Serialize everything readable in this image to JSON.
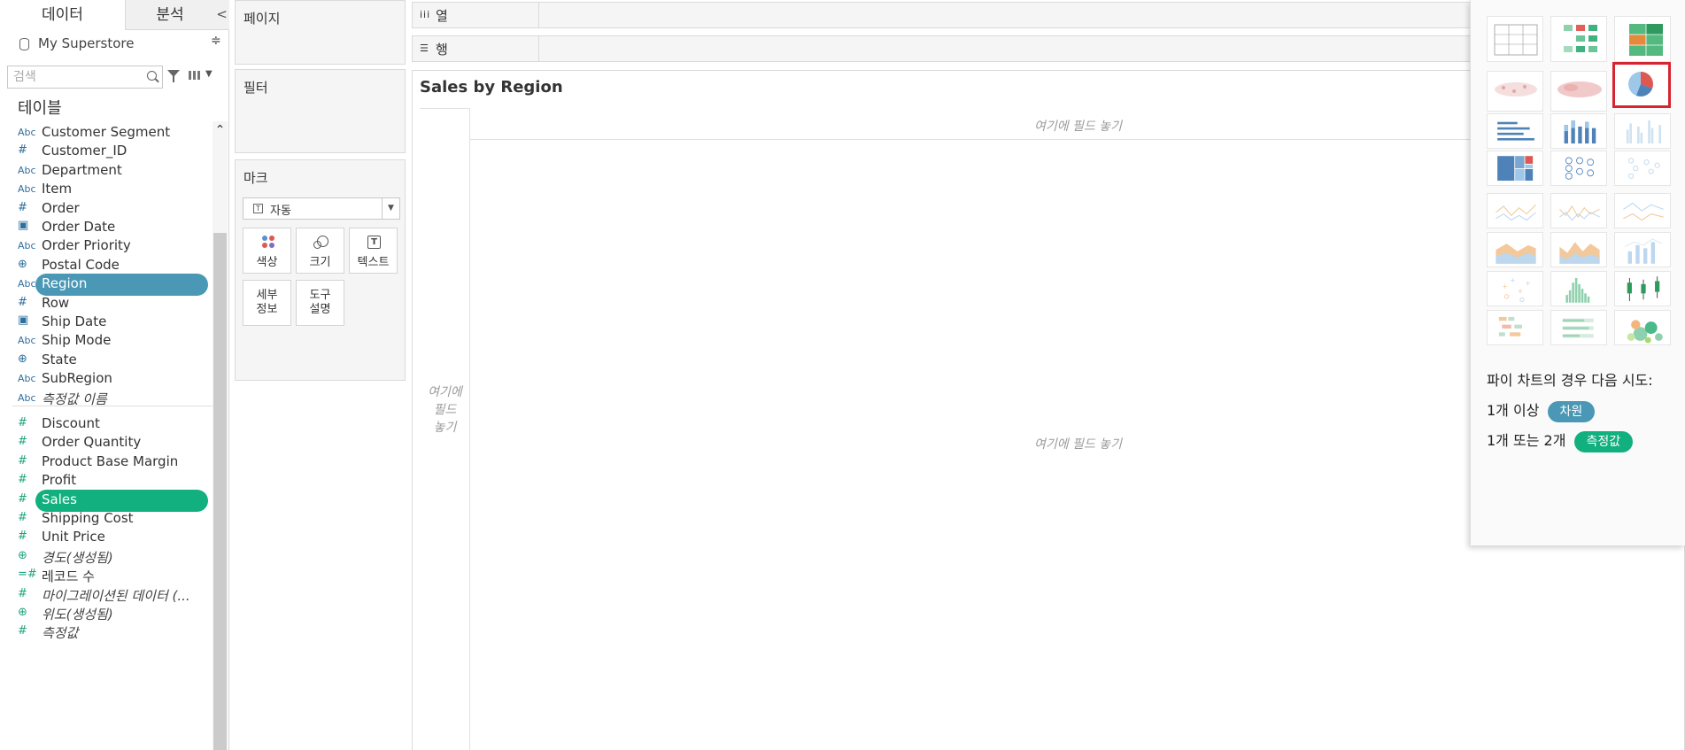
{
  "tabs": {
    "data": "데이터",
    "analysis": "분석",
    "collapse": "<"
  },
  "datasource": {
    "name": "My Superstore",
    "sort_icon": "≑"
  },
  "search": {
    "placeholder": "검색"
  },
  "tables_label": "테이블",
  "dimensions": [
    {
      "icon": "Abc",
      "type": "string",
      "label": "Customer Segment",
      "italic": false
    },
    {
      "icon": "#",
      "type": "number",
      "label": "Customer_ID",
      "italic": false
    },
    {
      "icon": "Abc",
      "type": "string",
      "label": "Department",
      "italic": false
    },
    {
      "icon": "Abc",
      "type": "string",
      "label": "Item",
      "italic": false
    },
    {
      "icon": "#",
      "type": "number",
      "label": "Order",
      "italic": false
    },
    {
      "icon": "date",
      "type": "date",
      "label": "Order Date",
      "italic": false
    },
    {
      "icon": "Abc",
      "type": "string",
      "label": "Order Priority",
      "italic": false
    },
    {
      "icon": "geo",
      "type": "geo",
      "label": "Postal Code",
      "italic": false
    },
    {
      "icon": "Abc",
      "type": "string",
      "label": "Region",
      "italic": false,
      "selected": true
    },
    {
      "icon": "#",
      "type": "number",
      "label": "Row",
      "italic": false
    },
    {
      "icon": "date",
      "type": "date",
      "label": "Ship Date",
      "italic": false
    },
    {
      "icon": "Abc",
      "type": "string",
      "label": "Ship Mode",
      "italic": false
    },
    {
      "icon": "geo",
      "type": "geo",
      "label": "State",
      "italic": false
    },
    {
      "icon": "Abc",
      "type": "string",
      "label": "SubRegion",
      "italic": false
    },
    {
      "icon": "Abc",
      "type": "string",
      "label": "측정값 이름",
      "italic": true
    }
  ],
  "measures": [
    {
      "icon": "#",
      "type": "measure",
      "label": "Discount",
      "italic": false
    },
    {
      "icon": "#",
      "type": "measure",
      "label": "Order Quantity",
      "italic": false
    },
    {
      "icon": "#",
      "type": "measure",
      "label": "Product Base Margin",
      "italic": false
    },
    {
      "icon": "#",
      "type": "measure",
      "label": "Profit",
      "italic": false
    },
    {
      "icon": "#",
      "type": "measure",
      "label": "Sales",
      "italic": false,
      "selected": true
    },
    {
      "icon": "#",
      "type": "measure",
      "label": "Shipping Cost",
      "italic": false
    },
    {
      "icon": "#",
      "type": "measure",
      "label": "Unit Price",
      "italic": false
    },
    {
      "icon": "geo",
      "type": "measure-geo",
      "label": "경도(생성됨)",
      "italic": true
    },
    {
      "icon": "=#",
      "type": "measure",
      "label": "레코드 수",
      "italic": false
    },
    {
      "icon": "#",
      "type": "measure",
      "label": "마이그레이션된 데이터 (...",
      "italic": true
    },
    {
      "icon": "geo",
      "type": "measure-geo",
      "label": "위도(생성됨)",
      "italic": true
    },
    {
      "icon": "#",
      "type": "measure",
      "label": "측정값",
      "italic": true
    }
  ],
  "cards": {
    "pages": "페이지",
    "filters": "필터",
    "marks": "마크"
  },
  "marks": {
    "mark_type": "자동",
    "mark_type_icon": "T",
    "buttons": {
      "color": "색상",
      "size": "크기",
      "text": "텍스트",
      "detail": "세부\n정보",
      "tooltip": "도구\n설명"
    }
  },
  "shelves": {
    "columns": {
      "icon": "iii",
      "label": "열"
    },
    "rows": {
      "icon": "☰",
      "label": "행"
    }
  },
  "view": {
    "title": "Sales by Region",
    "drop_columns": "여기에 필드 놓기",
    "drop_rows": "여기에\n필드\n놓기",
    "drop_cells": "여기에 필드 놓기"
  },
  "show_me": {
    "selected_chart": "pie",
    "hint_title": "파이 차트의 경우 다음 시도:",
    "hint_dim_prefix": "1개 이상",
    "hint_dim_pill": "차원",
    "hint_meas_prefix": "1개 또는 2개",
    "hint_meas_pill": "측정값"
  },
  "colors": {
    "dimension_pill": "#4a98b5",
    "measure_pill": "#12b07e",
    "selected_border": "#d62430"
  }
}
